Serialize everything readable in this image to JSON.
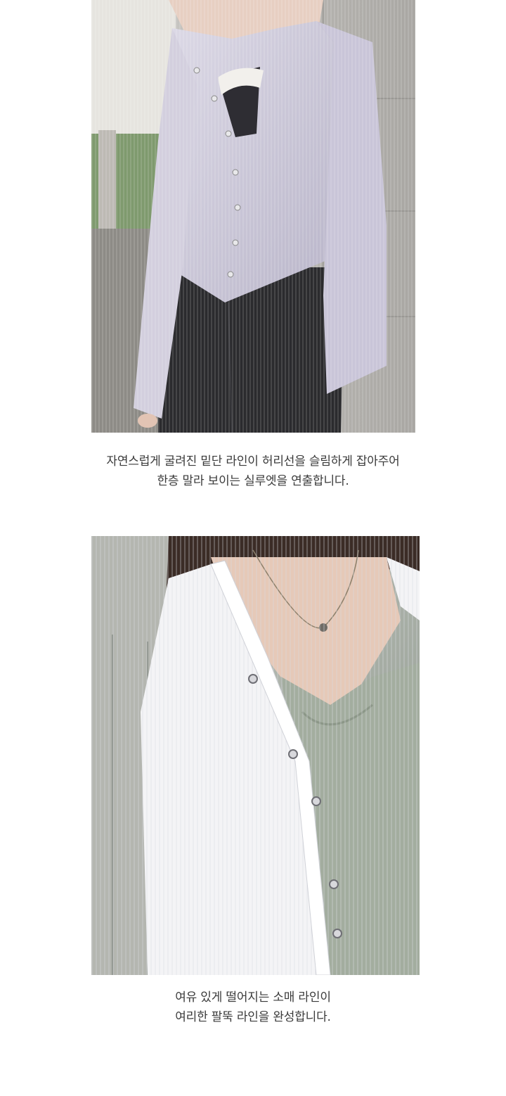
{
  "sections": [
    {
      "photo": {
        "alt": "lavender-ribbed-cardigan-photo",
        "colors": {
          "cardigan": "#cfcbdc",
          "jeans": "#2b2b2e",
          "wall": "#b8b6b2",
          "lace": "#f2f0ec"
        }
      },
      "caption_lines": [
        "자연스럽게 굴려진 밑단 라인이 허리선을 슬림하게 잡아주어",
        "한층 말라 보이는 실루엣을 연출합니다."
      ]
    },
    {
      "photo": {
        "alt": "white-ribbed-cardigan-photo",
        "colors": {
          "cardigan": "#f4f4f6",
          "top": "#a3ad9f",
          "wall": "#9aa39a",
          "hair": "#3b2c26"
        }
      },
      "caption_lines": [
        "여유 있게 떨어지는 소매 라인이",
        "여리한 팔뚝 라인을 완성합니다."
      ]
    }
  ]
}
